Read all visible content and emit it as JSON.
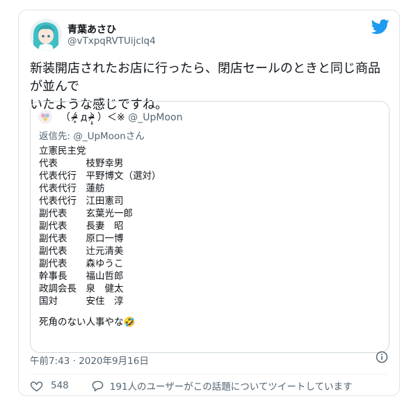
{
  "author": {
    "name": "青葉あさひ",
    "handle": "@vTxpqRVTUijclq4"
  },
  "tweet": {
    "text_line1": "新装開店されたお店に行ったら、閉店セールのときと同じ商品が並んで",
    "text_line2": "いたような感じですね。"
  },
  "quote": {
    "name": "（ ᵒ̴̶̷̥́ д ᵒ̴̶̷̣̥̀ ）＜※",
    "handle": "@_UpMoon",
    "reply_to": "返信先: @_UpMoonさん",
    "lines": [
      "立憲民主党",
      "代表　　　枝野幸男",
      "代表代行　平野博文（選対）",
      "代表代行　蓮舫",
      "代表代行　江田憲司",
      "副代表　　玄葉光一郎",
      "副代表　　長妻　昭",
      "副代表　　原口一博",
      "副代表　　辻元清美",
      "副代表　　森ゆうこ",
      "幹事長　　福山哲郎",
      "政調会長　泉　健太",
      "国対　　　安住　淳",
      "",
      "死角のない人事やな🤣"
    ]
  },
  "meta": {
    "timestamp": "午前7:43 · 2020年9月16日"
  },
  "actions": {
    "likes": "548",
    "reply_text": "191人のユーザーがこの話題についてツイートしています"
  },
  "colors": {
    "twitter_blue": "#1d9bf0",
    "secondary": "#536471",
    "border": "#cfd9de"
  },
  "icons": [
    "twitter-bird-icon",
    "info-icon",
    "heart-icon",
    "reply-icon"
  ]
}
